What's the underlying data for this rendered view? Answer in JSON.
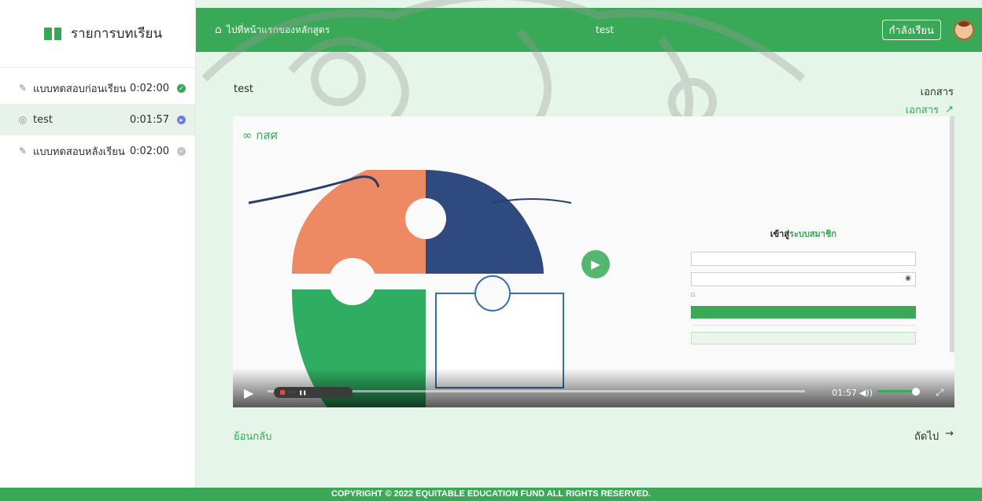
{
  "sidebar": {
    "title": "รายการบทเรียน",
    "items": [
      {
        "label": "แบบทดสอบก่อนเรียน",
        "time": "0:02:00",
        "status": "done",
        "active": false
      },
      {
        "label": "test",
        "time": "0:01:57",
        "status": "playing",
        "active": true
      },
      {
        "label": "แบบทดสอบหลังเรียน",
        "time": "0:02:00",
        "status": "pending",
        "active": false
      }
    ]
  },
  "topbar": {
    "home_label": "ไปที่หน้าแรกของหลักสูตร",
    "course_title": "test",
    "status_button": "กำลังเรียน"
  },
  "content": {
    "title": "test",
    "documents_label": "เอกสาร",
    "documents_link": "เอกสาร"
  },
  "video": {
    "logo_text": "กสศ",
    "login_heading_prefix": "เข้าสู่",
    "login_heading_suffix": "ระบบสมาชิก",
    "time": "01:57",
    "progress": 0.03,
    "volume": 0.9
  },
  "nav": {
    "back_label": "ย้อนกลับ",
    "next_label": "ถัดไป"
  },
  "footer": {
    "copyright": "COPYRIGHT © 2022 EQUITABLE EDUCATION FUND ALL RIGHTS RESERVED."
  },
  "colors": {
    "brand_green": "#3aa957",
    "background": "#e6f5ea",
    "puzzle_orange": "#ee8a63",
    "puzzle_navy": "#2e4a7e"
  }
}
